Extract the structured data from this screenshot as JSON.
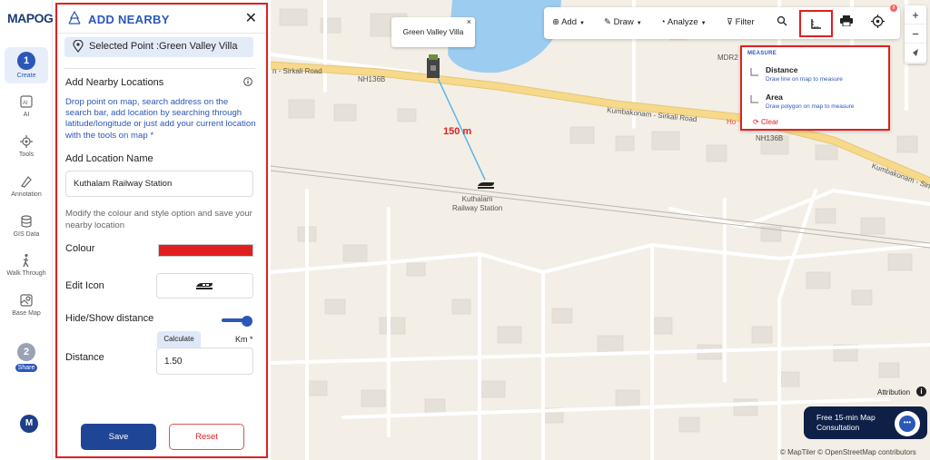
{
  "brand": {
    "logo_text": "MAPOG"
  },
  "rail": {
    "create": {
      "step": "1",
      "label": "Create"
    },
    "ai": {
      "label": "AI"
    },
    "tools": {
      "label": "Tools"
    },
    "annotation": {
      "label": "Annotation"
    },
    "gis_data": {
      "label": "GIS Data"
    },
    "walk_through": {
      "label": "Walk Through"
    },
    "base_map": {
      "label": "Base Map"
    },
    "share": {
      "step": "2",
      "label": "Share"
    },
    "avatar_initial": "M"
  },
  "panel": {
    "title": "ADD NEARBY",
    "close_label": "✕",
    "selected_point": "Selected Point :Green Valley Villa",
    "add_nearby_title": "Add Nearby Locations",
    "instructions": "Drop point on map, search address on the search bar, add location by searching through latitude/longitude or just add your current location with the tools on map *",
    "location_name_title": "Add Location Name",
    "location_name_value": "Kuthalam Railway Station",
    "style_help": "Modify the colour and style option and save your nearby location",
    "colour_label": "Colour",
    "colour_value": "#e02020",
    "edit_icon_label": "Edit Icon",
    "edit_icon_name": "train-icon",
    "hide_show_label": "Hide/Show distance",
    "hide_show_on": true,
    "calculate_label": "Calculate",
    "unit_label": "Km *",
    "distance_label": "Distance",
    "distance_value": "1.50",
    "save_label": "Save",
    "reset_label": "Reset"
  },
  "map": {
    "road_left": "n - Sirkali Road",
    "road_nh_1": "NH136B",
    "road_mid": "Kumbakonam - Sirkali Road",
    "road_right": "Kumbakonam - Sirk",
    "road_mdr": "MDR2",
    "road_nh_2": "NH136B",
    "place_ho": "Ho",
    "popup_title": "Green Valley Villa",
    "popup_close": "×",
    "distance_text": "150 m",
    "station_label_line1": "Kuthalam",
    "station_label_line2": "Railway Station"
  },
  "toolbar": {
    "add": "Add",
    "draw": "Draw",
    "analyze": "Analyze",
    "filter": "Filter",
    "badge": "8"
  },
  "measure_menu": {
    "title": "MEASURE",
    "distance_title": "Distance",
    "distance_desc": "Draw line on map to measure",
    "area_title": "Area",
    "area_desc": "Draw polygon on map to measure",
    "clear_label": "Clear"
  },
  "zoom": {
    "in": "+",
    "out": "−"
  },
  "attribution": {
    "label": "Attribution",
    "icon": "i"
  },
  "consultation": {
    "text": "Free 15-min Map Consultation"
  },
  "credits": "© MapTiler © OpenStreetMap contributors",
  "colors": {
    "accent": "#2b57b8",
    "highlight": "#e02020",
    "map_bg": "#f3efe6",
    "road_major": "#f7d98c",
    "water": "#9ccdf0"
  }
}
